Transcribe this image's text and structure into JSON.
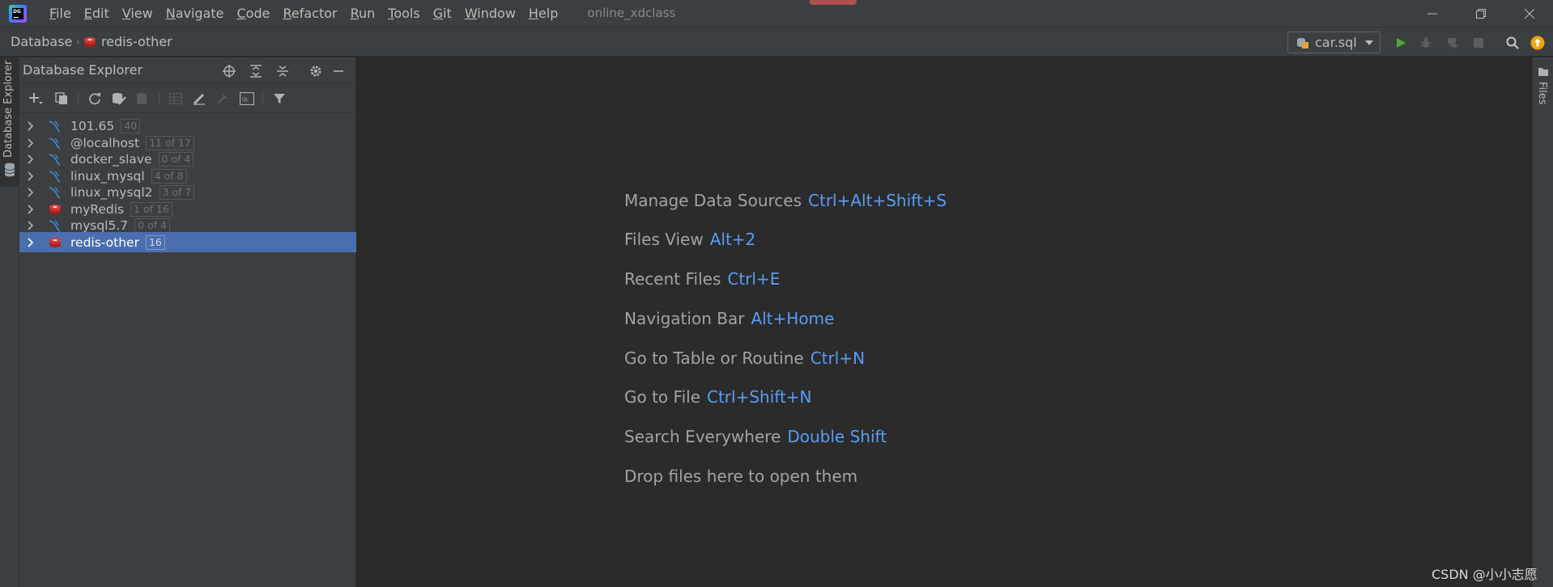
{
  "titlebar": {
    "logo_text": "DG",
    "menu": [
      {
        "label": "File",
        "mnemonic": "F",
        "rest": "ile"
      },
      {
        "label": "Edit",
        "mnemonic": "E",
        "rest": "dit"
      },
      {
        "label": "View",
        "mnemonic": "V",
        "rest": "iew"
      },
      {
        "label": "Navigate",
        "mnemonic": "N",
        "rest": "avigate"
      },
      {
        "label": "Code",
        "mnemonic": "C",
        "rest": "ode"
      },
      {
        "label": "Refactor",
        "mnemonic": "R",
        "rest": "efactor"
      },
      {
        "label": "Run",
        "mnemonic": "R",
        "rest": "un"
      },
      {
        "label": "Tools",
        "mnemonic": "T",
        "rest": "ools"
      },
      {
        "label": "Git",
        "mnemonic": "G",
        "rest": "it"
      },
      {
        "label": "Window",
        "mnemonic": "W",
        "rest": "indow"
      },
      {
        "label": "Help",
        "mnemonic": "H",
        "rest": "elp"
      }
    ],
    "project": "online_xdclass"
  },
  "navbar": {
    "breadcrumb_root": "Database",
    "breadcrumb_current": "redis-other",
    "run_config": "car.sql"
  },
  "left_stripe": {
    "label": "Database Explorer"
  },
  "db_panel": {
    "title": "Database Explorer",
    "tree": [
      {
        "label": "101.65",
        "badge": "40",
        "type": "mysql",
        "selected": false
      },
      {
        "label": "@localhost",
        "badge": "11 of 17",
        "type": "mysql",
        "selected": false
      },
      {
        "label": "docker_slave",
        "badge": "0 of 4",
        "type": "mysql",
        "selected": false
      },
      {
        "label": "linux_mysql",
        "badge": "4 of 8",
        "type": "mysql",
        "selected": false
      },
      {
        "label": "linux_mysql2",
        "badge": "3 of 7",
        "type": "mysql",
        "selected": false
      },
      {
        "label": "myRedis",
        "badge": "1 of 16",
        "type": "redis",
        "selected": false
      },
      {
        "label": "mysql5.7",
        "badge": "0 of 4",
        "type": "mysql",
        "selected": false
      },
      {
        "label": "redis-other",
        "badge": "16",
        "type": "redis",
        "selected": true
      }
    ]
  },
  "editor": {
    "hints": [
      {
        "text": "Manage Data Sources",
        "shortcut": "Ctrl+Alt+Shift+S"
      },
      {
        "text": "Files View",
        "shortcut": "Alt+2"
      },
      {
        "text": "Recent Files",
        "shortcut": "Ctrl+E"
      },
      {
        "text": "Navigation Bar",
        "shortcut": "Alt+Home"
      },
      {
        "text": "Go to Table or Routine",
        "shortcut": "Ctrl+N"
      },
      {
        "text": "Go to File",
        "shortcut": "Ctrl+Shift+N"
      },
      {
        "text": "Search Everywhere",
        "shortcut": "Double Shift"
      },
      {
        "text": "Drop files here to open them",
        "shortcut": ""
      }
    ]
  },
  "right_stripe": {
    "label": "Files"
  },
  "watermark": "CSDN @小小志愿",
  "colors": {
    "background": "#2b2b2b",
    "panel": "#3c3f41",
    "selection": "#4b6eaf",
    "shortcut": "#589df6",
    "mysql_icon": "#3f8dd4",
    "redis_icon": "#d52b2b",
    "run_green": "#4fa83c",
    "update_orange": "#f0a30a"
  }
}
